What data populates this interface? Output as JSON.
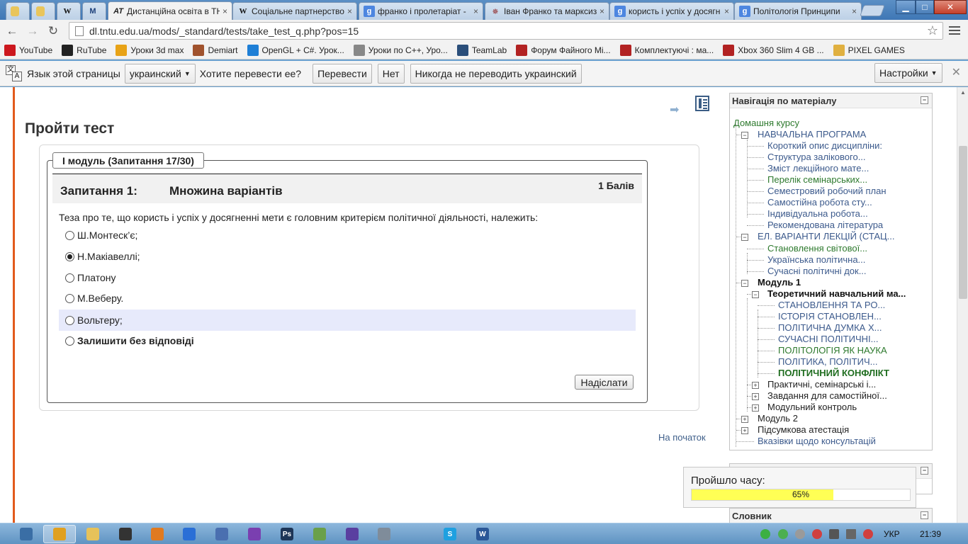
{
  "browser": {
    "tabs": [
      {
        "title": "",
        "icon": "lock-icon"
      },
      {
        "title": "",
        "icon": "lock-icon"
      },
      {
        "title": "",
        "icon": "W"
      },
      {
        "title": "",
        "icon": "M"
      },
      {
        "title": "Дистанційна освіта в ТН",
        "icon": "AT"
      },
      {
        "title": "Соціальне партнерство",
        "icon": "W"
      },
      {
        "title": "франко і пролетаріат -",
        "icon": "g"
      },
      {
        "title": "Іван Франко та марксизм",
        "icon": "star"
      },
      {
        "title": "користь і успіх у досягн",
        "icon": "g"
      },
      {
        "title": "Політологія Принципи",
        "icon": "g"
      }
    ],
    "close_glyph": "×",
    "url": "dl.tntu.edu.ua/mods/_standard/tests/take_test_q.php?pos=15",
    "bookmarks": [
      {
        "label": "YouTube",
        "color": "#cc181e"
      },
      {
        "label": "RuTube",
        "color": "#222222"
      },
      {
        "label": "Уроки 3d max",
        "color": "#e8a317"
      },
      {
        "label": "Demiart",
        "color": "#a0522d"
      },
      {
        "label": "OpenGL + C#. Урок...",
        "color": "#1e7fd6"
      },
      {
        "label": "Уроки по C++, Уро...",
        "color": "#888888"
      },
      {
        "label": "TeamLab",
        "color": "#2a4e7a"
      },
      {
        "label": "Форум Файного Мі...",
        "color": "#b22222"
      },
      {
        "label": "Комплектуючі : ма...",
        "color": "#b22222"
      },
      {
        "label": "Xbox 360 Slim 4 GB ...",
        "color": "#b22222"
      },
      {
        "label": "PIXEL GAMES",
        "color": "#e0b040"
      }
    ],
    "translate": {
      "prompt": "Язык этой страницы",
      "language": "украинский",
      "question": "Хотите перевести ее?",
      "translate_btn": "Перевести",
      "no_btn": "Нет",
      "never_btn": "Никогда не переводить украинский",
      "settings_btn": "Настройки"
    }
  },
  "page": {
    "title": "Пройти тест",
    "module_legend": "I модуль (Запитання 17/30)",
    "question": {
      "number": "Запитання 1:",
      "type": "Множина варіантів",
      "grade": "1 Балів",
      "text": "Теза про те, що користь і успіх у досягненні мети є головним критерієм політичної діяльності, належить:",
      "answers": [
        {
          "label": "Ш.Монтеск’є;",
          "checked": false
        },
        {
          "label": "Н.Макіавеллі;",
          "checked": true
        },
        {
          "label": "Платону",
          "checked": false
        },
        {
          "label": "М.Веберу.",
          "checked": false
        },
        {
          "label": "Вольтеру;",
          "checked": false
        },
        {
          "label": "Залишити без відповіді",
          "checked": false
        }
      ]
    },
    "submit_label": "Надіслати",
    "to_top": "На початок",
    "timer": {
      "label": "Пройшло часу:",
      "progress_percent": 65,
      "progress_text": "65%"
    }
  },
  "sidebar": {
    "nav_title": "Навігація по матеріалу",
    "glossary_title": "Словник",
    "home": "Домашня курсу",
    "tree": [
      {
        "label": "НАВЧАЛЬНА ПРОГРАМА",
        "level": 1,
        "toggle": "minus",
        "style": "link"
      },
      {
        "label": "Короткий опис дисципліни:",
        "level": 2,
        "style": "link"
      },
      {
        "label": "Структура залікового...",
        "level": 2,
        "style": "link"
      },
      {
        "label": "Зміст лекційного мате...",
        "level": 2,
        "style": "link"
      },
      {
        "label": "Перелік семінарських...",
        "level": 2,
        "style": "green"
      },
      {
        "label": "Семестровий робочий план",
        "level": 2,
        "style": "link"
      },
      {
        "label": "Самостійна робота сту...",
        "level": 2,
        "style": "link"
      },
      {
        "label": "Індивідуальна робота...",
        "level": 2,
        "style": "link"
      },
      {
        "label": "Рекомендована література",
        "level": 2,
        "style": "link"
      },
      {
        "label": "ЕЛ. ВАРІАНТИ ЛЕКЦІЙ (СТАЦ...",
        "level": 1,
        "toggle": "minus",
        "style": "link"
      },
      {
        "label": "Становлення світової...",
        "level": 2,
        "style": "green"
      },
      {
        "label": "Українська політична...",
        "level": 2,
        "style": "link"
      },
      {
        "label": "Сучасні політичні док...",
        "level": 2,
        "style": "link"
      },
      {
        "label": "Модуль 1",
        "level": 1,
        "toggle": "minus",
        "style": "black"
      },
      {
        "label": "Теоретичний навчальний ма...",
        "level": 2,
        "toggle": "minus",
        "style": "black"
      },
      {
        "label": "СТАНОВЛЕННЯ ТА РО...",
        "level": 3,
        "style": "link"
      },
      {
        "label": "ІСТОРІЯ СТАНОВЛЕН...",
        "level": 3,
        "style": "link"
      },
      {
        "label": "ПОЛІТИЧНА ДУМКА Х...",
        "level": 3,
        "style": "link"
      },
      {
        "label": "СУЧАСНІ ПОЛІТИЧНІ...",
        "level": 3,
        "style": "link"
      },
      {
        "label": "ПОЛІТОЛОГІЯ ЯК НАУКА",
        "level": 3,
        "style": "green"
      },
      {
        "label": "ПОЛІТИКА, ПОЛІТИЧ...",
        "level": 3,
        "style": "link"
      },
      {
        "label": "ПОЛІТИЧНИЙ КОНФЛІКТ",
        "level": 3,
        "style": "current"
      },
      {
        "label": "Практичні, семінарські і...",
        "level": 2,
        "toggle": "plus",
        "style": "plain"
      },
      {
        "label": "Завдання для самостійної...",
        "level": 2,
        "toggle": "plus",
        "style": "plain"
      },
      {
        "label": "Модульний контроль",
        "level": 2,
        "toggle": "plus",
        "style": "plain"
      },
      {
        "label": "Модуль 2",
        "level": 1,
        "toggle": "plus",
        "style": "plain"
      },
      {
        "label": "Підсумкова атестація",
        "level": 1,
        "toggle": "plus",
        "style": "plain"
      },
      {
        "label": "Вказівки щодо консультацій",
        "level": 1,
        "style": "link"
      }
    ]
  },
  "taskbar": {
    "apps": [
      {
        "name": "explorer",
        "color": "#3a6ea5",
        "glyph": "",
        "active": false
      },
      {
        "name": "chrome",
        "color": "#e0a020",
        "glyph": "",
        "active": true
      },
      {
        "name": "folder",
        "color": "#e6c25a",
        "glyph": "",
        "active": false
      },
      {
        "name": "clapperboard",
        "color": "#333333",
        "glyph": "",
        "active": false
      },
      {
        "name": "media",
        "color": "#e07a20",
        "glyph": "",
        "active": false
      },
      {
        "name": "lightning",
        "color": "#2a6fd6",
        "glyph": "",
        "active": false
      },
      {
        "name": "mask",
        "color": "#4a6fb0",
        "glyph": "",
        "active": false
      },
      {
        "name": "visual-studio",
        "color": "#7a3fb0",
        "glyph": "",
        "active": false
      },
      {
        "name": "photoshop",
        "color": "#1d3557",
        "glyph": "Ps",
        "active": false
      },
      {
        "name": "notepad",
        "color": "#6aa04a",
        "glyph": "",
        "active": false
      },
      {
        "name": "app-purple",
        "color": "#5a3fa0",
        "glyph": "",
        "active": false
      },
      {
        "name": "calculator",
        "color": "#7f8c9a",
        "glyph": "",
        "active": false
      },
      {
        "name": "skype",
        "color": "#1fa0e0",
        "glyph": "S",
        "active": false
      },
      {
        "name": "word",
        "color": "#2b5797",
        "glyph": "W",
        "active": false
      }
    ],
    "lang": "УКР",
    "clock": "21:39"
  }
}
